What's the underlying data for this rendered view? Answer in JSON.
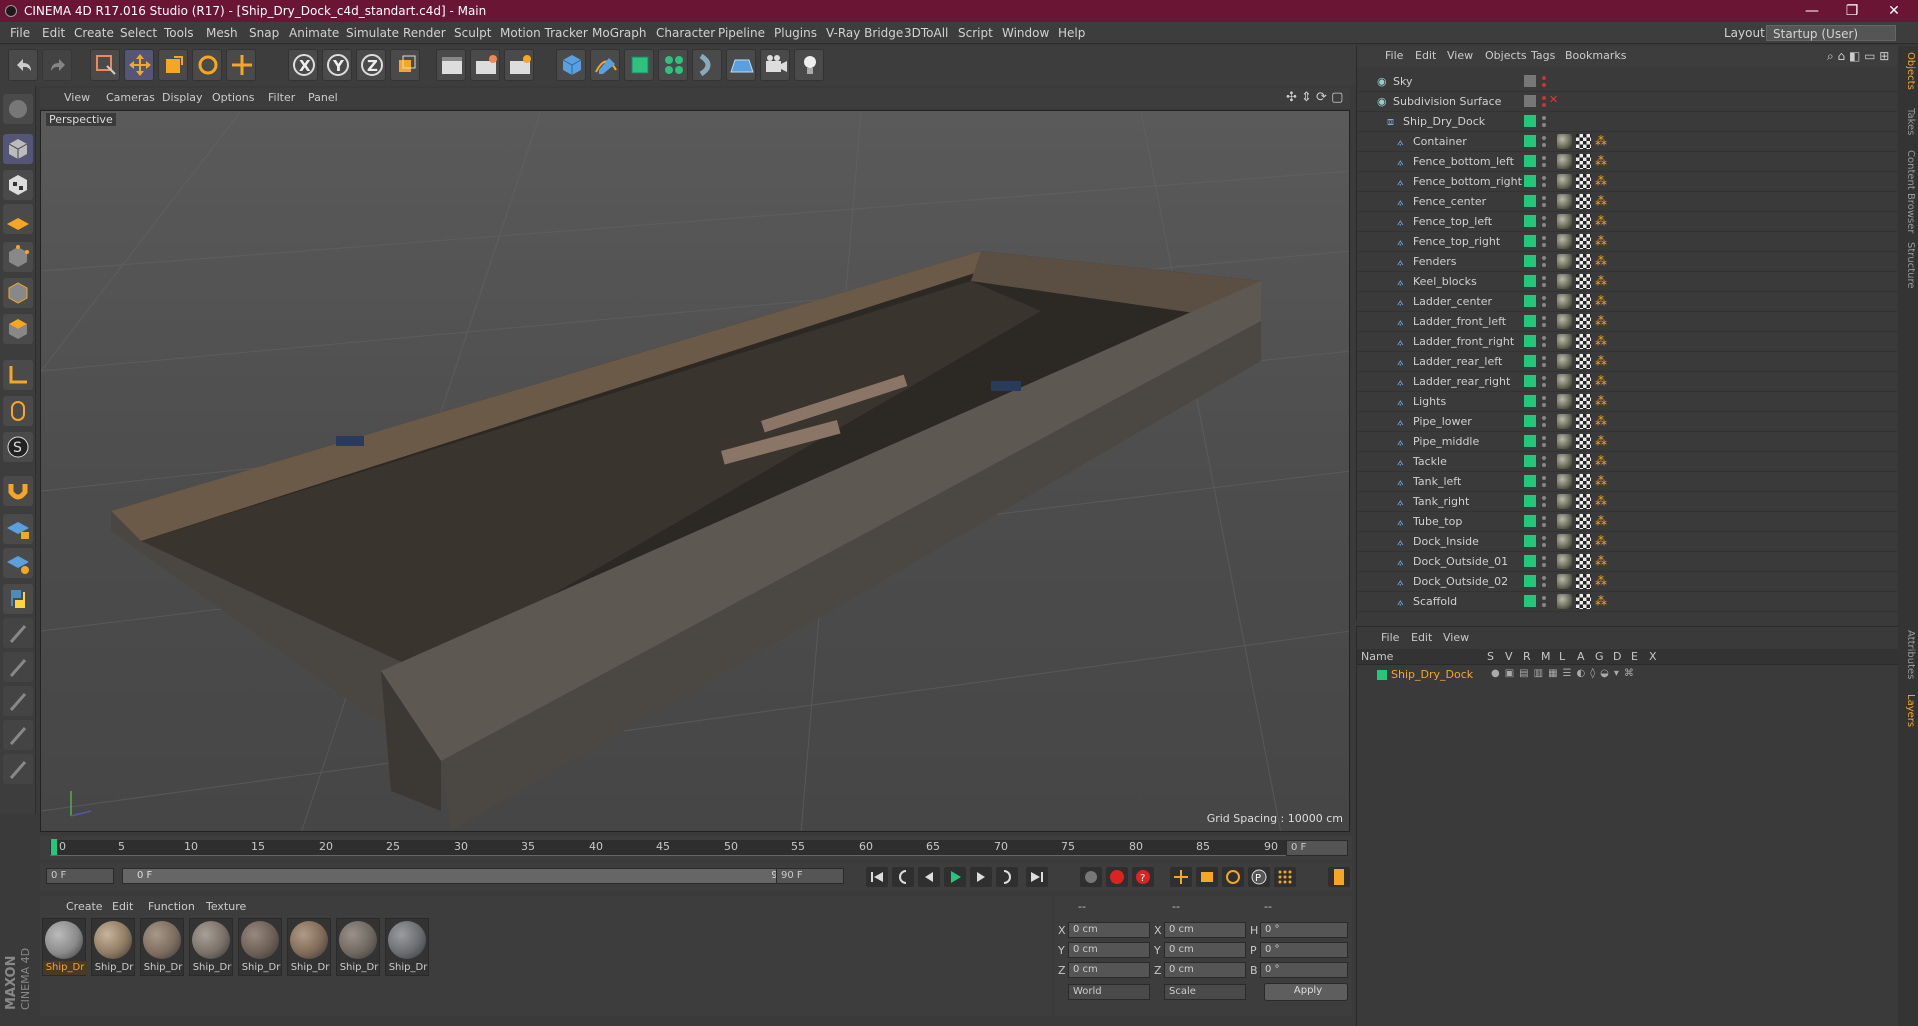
{
  "window": {
    "title": "CINEMA 4D R17.016 Studio (R17) - [Ship_Dry_Dock_c4d_standart.c4d] - Main",
    "minimize": "—",
    "restore": "❐",
    "close": "✕"
  },
  "menubar": {
    "items": [
      "File",
      "Edit",
      "Create",
      "Select",
      "Tools",
      "Mesh",
      "Snap",
      "Animate",
      "Simulate",
      "Render",
      "Sculpt",
      "Motion Tracker",
      "MoGraph",
      "Character",
      "Pipeline",
      "Plugins",
      "V-Ray Bridge",
      "3DToAll",
      "Script",
      "Window",
      "Help"
    ],
    "layout_label": "Layout:",
    "layout_value": "Startup (User)"
  },
  "toolbar": {
    "axis_labels": [
      "X",
      "Y",
      "Z"
    ]
  },
  "viewport": {
    "menu": [
      "View",
      "Cameras",
      "Display",
      "Options",
      "Filter",
      "Panel"
    ],
    "label": "Perspective",
    "grid_spacing": "Grid Spacing : 10000 cm"
  },
  "timeline": {
    "ticks": [
      "0",
      "5",
      "10",
      "15",
      "20",
      "25",
      "30",
      "35",
      "40",
      "45",
      "50",
      "55",
      "60",
      "65",
      "70",
      "75",
      "80",
      "85",
      "90"
    ],
    "current_frame": "0 F"
  },
  "transport": {
    "start_field": "0 F",
    "range_start": "0 F",
    "range_end": "90 F",
    "end_field": "90 F"
  },
  "materials": {
    "menu": [
      "Create",
      "Edit",
      "Function",
      "Texture"
    ],
    "items": [
      {
        "label": "Ship_Dr",
        "color": "#8a8a8a",
        "selected": true
      },
      {
        "label": "Ship_Dr",
        "color": "#8f7a62",
        "selected": false
      },
      {
        "label": "Ship_Dr",
        "color": "#7d6d60",
        "selected": false
      },
      {
        "label": "Ship_Dr",
        "color": "#7a7068",
        "selected": false
      },
      {
        "label": "Ship_Dr",
        "color": "#6d5f56",
        "selected": false
      },
      {
        "label": "Ship_Dr",
        "color": "#806a58",
        "selected": false
      },
      {
        "label": "Ship_Dr",
        "color": "#6f6860",
        "selected": false
      },
      {
        "label": "Ship_Dr",
        "color": "#6a6c70",
        "selected": false
      }
    ]
  },
  "coords": {
    "headers": [
      "--",
      "--",
      "--"
    ],
    "rows": [
      {
        "a": "X",
        "av": "0 cm",
        "b": "X",
        "bv": "0 cm",
        "c": "H",
        "cv": "0 °"
      },
      {
        "a": "Y",
        "av": "0 cm",
        "b": "Y",
        "bv": "0 cm",
        "c": "P",
        "cv": "0 °"
      },
      {
        "a": "Z",
        "av": "0 cm",
        "b": "Z",
        "bv": "0 cm",
        "c": "B",
        "cv": "0 °"
      }
    ],
    "world": "World",
    "scale": "Scale",
    "apply": "Apply"
  },
  "object_manager": {
    "menu": [
      "File",
      "Edit",
      "View",
      "Objects",
      "Tags",
      "Bookmarks"
    ],
    "objects": [
      {
        "name": "Sky",
        "level": 0
      },
      {
        "name": "Subdivision Surface",
        "level": 0
      },
      {
        "name": "Ship_Dry_Dock",
        "level": 1
      },
      {
        "name": "Container",
        "level": 2
      },
      {
        "name": "Fence_bottom_left",
        "level": 2
      },
      {
        "name": "Fence_bottom_right",
        "level": 2
      },
      {
        "name": "Fence_center",
        "level": 2
      },
      {
        "name": "Fence_top_left",
        "level": 2
      },
      {
        "name": "Fence_top_right",
        "level": 2
      },
      {
        "name": "Fenders",
        "level": 2
      },
      {
        "name": "Keel_blocks",
        "level": 2
      },
      {
        "name": "Ladder_center",
        "level": 2
      },
      {
        "name": "Ladder_front_left",
        "level": 2
      },
      {
        "name": "Ladder_front_right",
        "level": 2
      },
      {
        "name": "Ladder_rear_left",
        "level": 2
      },
      {
        "name": "Ladder_rear_right",
        "level": 2
      },
      {
        "name": "Lights",
        "level": 2
      },
      {
        "name": "Pipe_lower",
        "level": 2
      },
      {
        "name": "Pipe_middle",
        "level": 2
      },
      {
        "name": "Tackle",
        "level": 2
      },
      {
        "name": "Tank_left",
        "level": 2
      },
      {
        "name": "Tank_right",
        "level": 2
      },
      {
        "name": "Tube_top",
        "level": 2
      },
      {
        "name": "Dock_Inside",
        "level": 2
      },
      {
        "name": "Dock_Outside_01",
        "level": 2
      },
      {
        "name": "Dock_Outside_02",
        "level": 2
      },
      {
        "name": "Scaffold",
        "level": 2
      }
    ]
  },
  "layer_manager": {
    "menu": [
      "File",
      "Edit",
      "View"
    ],
    "columns": [
      "Name",
      "S",
      "V",
      "R",
      "M",
      "L",
      "A",
      "G",
      "D",
      "E",
      "X"
    ],
    "layer_name": "Ship_Dry_Dock",
    "layer_color": "#22c77a"
  },
  "right_tabs": [
    "Objects",
    "Takes",
    "Content Browser",
    "Structure",
    "Attributes",
    "Layers"
  ],
  "brand": {
    "maxon": "MAXON",
    "c4d": "CINEMA 4D"
  },
  "colors": {
    "accent": "#22c77a",
    "title_bar": "#6b1535",
    "selection_orange": "#f5a623"
  }
}
